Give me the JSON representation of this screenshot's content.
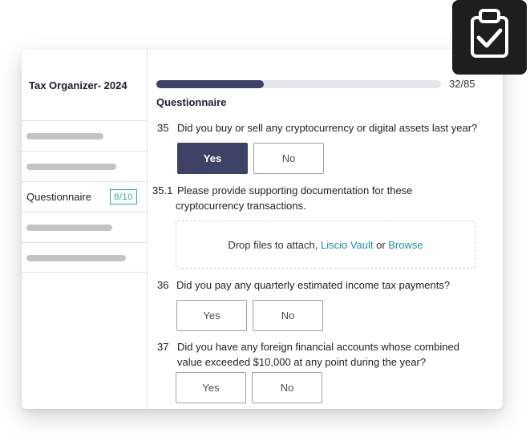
{
  "sidebar": {
    "title": "Tax Organizer- 2024",
    "active_item": {
      "label": "Questionnaire",
      "badge": "8/10"
    }
  },
  "progress": {
    "current": 32,
    "total": 85,
    "label": "32/85"
  },
  "section_title": "Questionnaire",
  "questions": [
    {
      "number": "35",
      "text": "Did you buy or sell any cryptocurrency or digital assets last year?",
      "yes": "Yes",
      "no": "No",
      "selected": "Yes"
    },
    {
      "number": "35.1",
      "line1": "Please provide supporting documentation for these",
      "line2": "cryptocurrency transactions."
    },
    {
      "number": "36",
      "text": "Did you pay any quarterly estimated income tax payments?",
      "yes": "Yes",
      "no": "No"
    },
    {
      "number": "37",
      "line1": "Did you have any foreign financial accounts whose combined",
      "line2": "value exceeded $10,000 at any point during the year?",
      "yes": "Yes",
      "no": "No"
    }
  ],
  "dropzone": {
    "prefix": "Drop files to attach,",
    "vault": "Liscio Vault",
    "or": "or",
    "browse": "Browse"
  },
  "colors": {
    "primary": "#3e4266",
    "accent": "#2aa5b3",
    "link": "#1f8ea3",
    "placeholder": "#c4c4c4"
  },
  "icons": {
    "corner": "clipboard-check-icon"
  }
}
